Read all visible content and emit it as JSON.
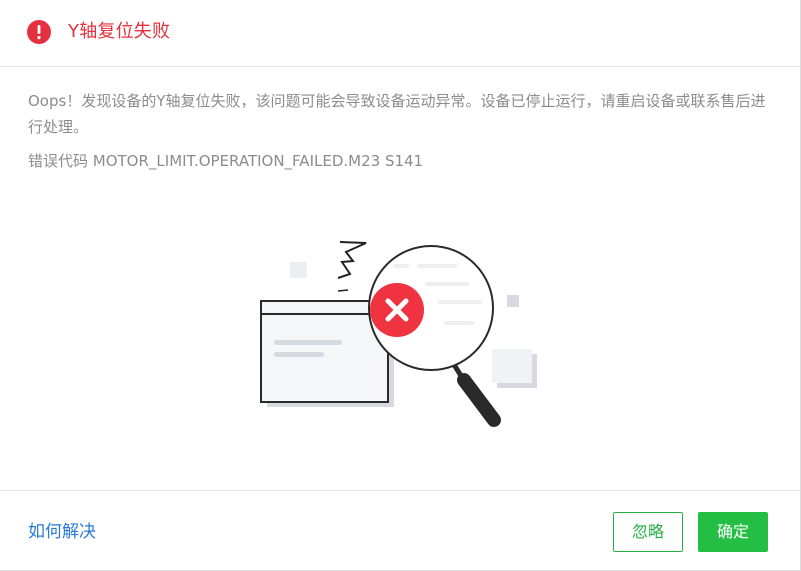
{
  "dialog": {
    "title": "Y轴复位失败",
    "message": "Oops！发现设备的Y轴复位失败，该问题可能会导致设备运动异常。设备已停止运行，请重启设备或联系售后进行处理。",
    "error_code": "错误代码 MOTOR_LIMIT.OPERATION_FAILED.M23 S141"
  },
  "footer": {
    "help_link": "如何解决",
    "ignore_label": "忽略",
    "confirm_label": "确定"
  },
  "icons": {
    "title_icon": "error-circle-icon",
    "illustration": "magnifier-error-illustration"
  },
  "colors": {
    "error_red": "#e5303f",
    "primary_green": "#25be44",
    "link_blue": "#2b7bd6",
    "text_gray": "#8c8c8c"
  }
}
